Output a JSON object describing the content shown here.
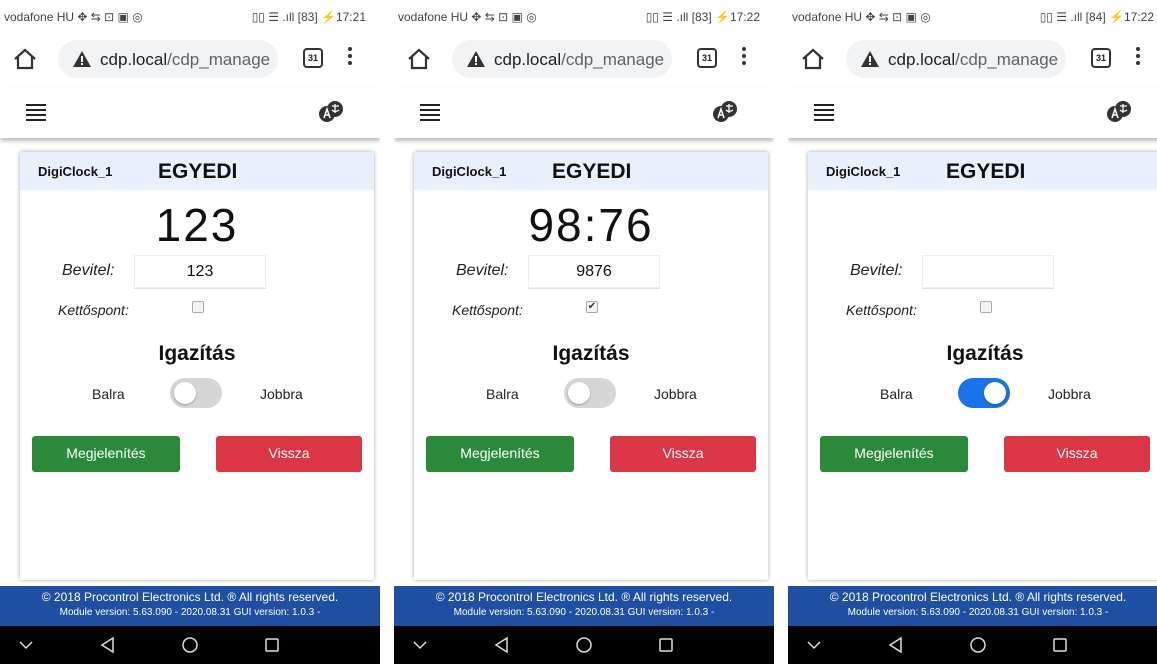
{
  "status": {
    "carrier": "vodafone HU ✥ ⇆ ⊡ ▣ ◎"
  },
  "phones": [
    {
      "system": "▯▯ ☰ .ıll [83] ⚡17:21",
      "display": "123",
      "input": "123",
      "colon": false,
      "align_right": false
    },
    {
      "system": "▯▯ ☰ .ıll [83] ⚡17:22",
      "display": "98:76",
      "input": "9876",
      "colon": true,
      "align_right": false
    },
    {
      "system": "▯▯ ☰ .ıll [84] ⚡17:22",
      "display": "",
      "input": "",
      "colon": false,
      "align_right": true
    }
  ],
  "browser": {
    "url_host": "cdp.local",
    "url_path": "/cdp_manage",
    "tabs_count": "31"
  },
  "card": {
    "device_name": "DigiClock_1",
    "mode": "EGYEDI",
    "input_label": "Bevitel:",
    "colon_label": "Kettőspont:",
    "align_title": "Igazítás",
    "left_label": "Balra",
    "right_label": "Jobbra",
    "show_button": "Megjelenítés",
    "back_button": "Vissza"
  },
  "footer": {
    "copyright": "© 2018 Procontrol Electronics Ltd. ® All rights reserved.",
    "version": "Module version: 5.63.090 - 2020.08.31    GUI version: 1.0.3 -"
  },
  "colors": {
    "show": "#2a8a3a",
    "back": "#dc3545",
    "toggle_on": "#1a73e8",
    "footer": "#1f4fa0"
  }
}
